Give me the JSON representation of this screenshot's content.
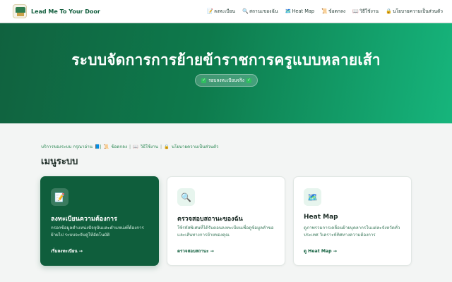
{
  "brand": {
    "name": "Lead Me To Your Door",
    "logo": "lead-me-logo"
  },
  "nav": [
    {
      "icon": "📝",
      "label": "ลงทะเบียน"
    },
    {
      "icon": "🔍",
      "label": "สถานะของฉัน"
    },
    {
      "icon": "🗺️",
      "label": "Heat Map"
    },
    {
      "icon": "📜",
      "label": "ข้อตกลง"
    },
    {
      "icon": "📖",
      "label": "วิธีใช้งาน"
    },
    {
      "icon": "🔒",
      "label": "นโยบายความเป็นส่วนตัว"
    }
  ],
  "hero": {
    "title": "ระบบจัดการการย้ายข้าราชการครูแบบหลายเส้า",
    "badge": "รอบลงทะเบียนจริง"
  },
  "notice": {
    "prefix": "บริการของระบบ กรุณาอ่าน",
    "links": [
      "ข้อตกลง",
      "วิธีใช้งาน",
      "นโยบายความเป็นส่วนตัว"
    ],
    "separator": "|"
  },
  "section_title": "เมนูระบบ",
  "cards": [
    {
      "icon": "📝",
      "title": "ลงทะเบียนความต้องการ",
      "desc": "กรอกข้อมูลตำแหน่งปัจจุบันและตำแหน่งที่ต้องการย้ายไป ระบบจะจับคู่ให้อัตโนมัติ",
      "link": "เริ่มลงทะเบียน →"
    },
    {
      "icon": "🔍",
      "title": "ตรวจสอบสถานะของฉัน",
      "desc": "ใช้รหัสพิเศษที่ได้รับตอนลงทะเบียนเพื่อดูข้อมูลคำขอและเส้นทางการย้ายของคุณ",
      "link": "ตรวจสอบสถานะ →"
    },
    {
      "icon": "🗺️",
      "title": "Heat Map",
      "desc": "ดูภาพรวมการเคลื่อนย้ายบุคลากรในแต่ละจังหวัดทั่วประเทศ วิเคราะห์ทิศทางความต้องการ",
      "link": "ดู Heat Map →"
    }
  ],
  "colors": {
    "primary": "#0f5e3c",
    "accent": "#16b57c",
    "background": "#f3f5f4"
  }
}
